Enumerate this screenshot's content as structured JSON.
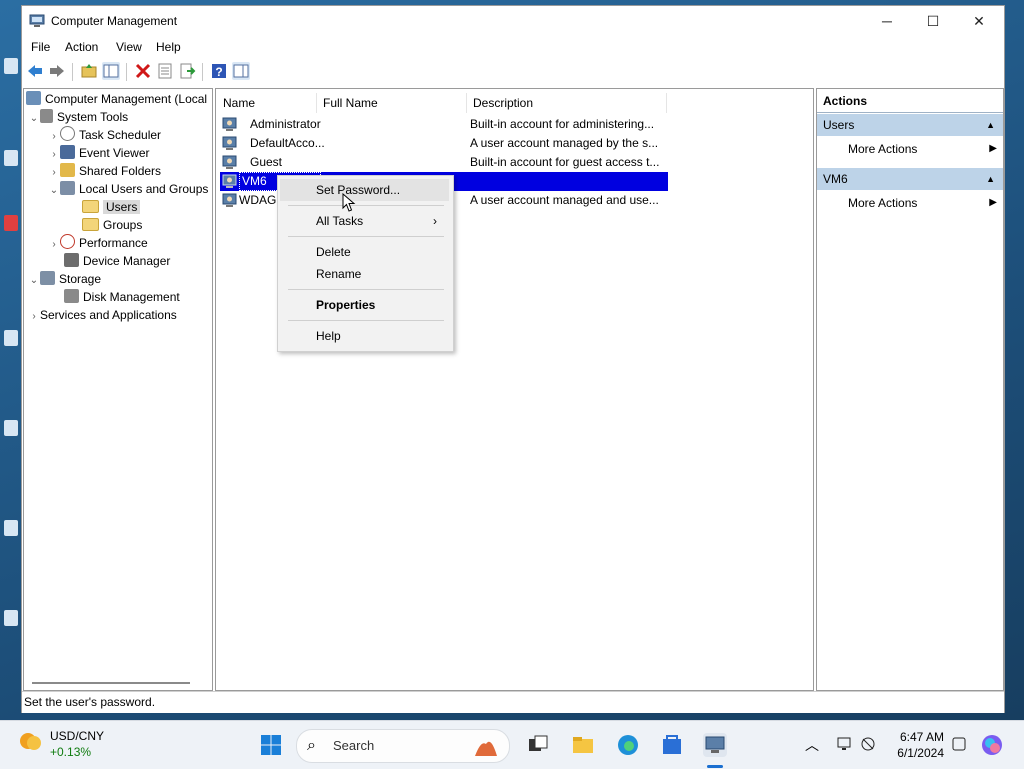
{
  "window": {
    "title": "Computer Management",
    "controls": {
      "minimize": "─",
      "maximize": "☐",
      "close": "✕"
    }
  },
  "menu": [
    "File",
    "Action",
    "View",
    "Help"
  ],
  "tree": {
    "items": [
      {
        "label": "Computer Management (Local",
        "icon": "computer-management-icon",
        "chevron": ""
      },
      {
        "label": "System Tools",
        "icon": "tools-icon",
        "chevron": "⌄"
      },
      {
        "label": "Task Scheduler",
        "icon": "clock-icon",
        "chevron": "›"
      },
      {
        "label": "Event Viewer",
        "icon": "event-viewer-icon",
        "chevron": "›"
      },
      {
        "label": "Shared Folders",
        "icon": "shared-folder-icon",
        "chevron": "›"
      },
      {
        "label": "Local Users and Groups",
        "icon": "users-groups-icon",
        "chevron": "⌄"
      },
      {
        "label": "Users",
        "icon": "folder-icon",
        "chevron": ""
      },
      {
        "label": "Groups",
        "icon": "folder-icon",
        "chevron": ""
      },
      {
        "label": "Performance",
        "icon": "performance-icon",
        "chevron": "›"
      },
      {
        "label": "Device Manager",
        "icon": "device-manager-icon",
        "chevron": ""
      },
      {
        "label": "Storage",
        "icon": "storage-icon",
        "chevron": "⌄"
      },
      {
        "label": "Disk Management",
        "icon": "disk-icon",
        "chevron": ""
      },
      {
        "label": "Services and Applications",
        "icon": "services-icon",
        "chevron": "›"
      }
    ]
  },
  "list": {
    "columns": [
      "Name",
      "Full Name",
      "Description"
    ],
    "rows": [
      {
        "name": "Administrator",
        "full_name": "",
        "description": "Built-in account for administering..."
      },
      {
        "name": "DefaultAcco...",
        "full_name": "",
        "description": "A user account managed by the s..."
      },
      {
        "name": "Guest",
        "full_name": "",
        "description": "Built-in account for guest access t..."
      },
      {
        "name": "VM6",
        "full_name": "",
        "description": ""
      },
      {
        "name": "WDAGU",
        "full_name": "",
        "description": "A user account managed and use..."
      }
    ]
  },
  "context_menu": {
    "set_password": "Set Password...",
    "all_tasks": "All Tasks",
    "delete": "Delete",
    "rename": "Rename",
    "properties": "Properties",
    "help": "Help"
  },
  "actions": {
    "header": "Actions",
    "sections": [
      {
        "title": "Users",
        "item": "More Actions"
      },
      {
        "title": "VM6",
        "item": "More Actions"
      }
    ]
  },
  "status": "Set the user's password.",
  "taskbar": {
    "ticker_name": "USD/CNY",
    "ticker_change": "+0.13%",
    "search_placeholder": "Search",
    "time": "6:47 AM",
    "date": "6/1/2024"
  },
  "colors": {
    "selection": "#0000e0",
    "actions_subheader": "#bdd3e8"
  }
}
